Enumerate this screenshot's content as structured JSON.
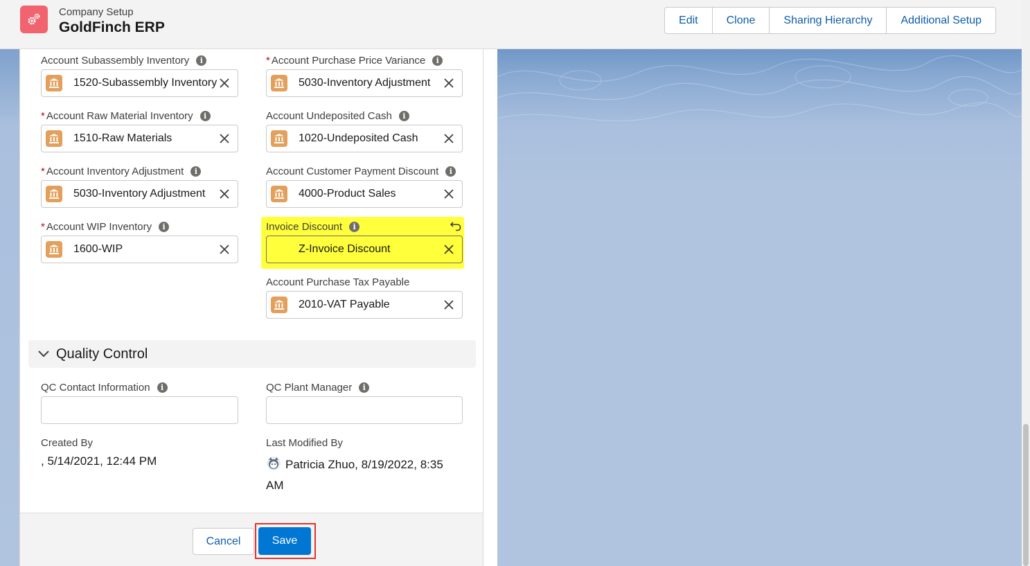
{
  "header": {
    "subtitle": "Company Setup",
    "title": "GoldFinch ERP",
    "actions": [
      "Edit",
      "Clone",
      "Sharing Hierarchy",
      "Additional Setup"
    ]
  },
  "fields": {
    "f1": {
      "label": "Account Subassembly Inventory",
      "required": false,
      "value": "1520-Subassembly Inventory"
    },
    "f2": {
      "label": "Account Purchase Price Variance",
      "required": true,
      "value": "5030-Inventory Adjustment"
    },
    "f3": {
      "label": "Account Raw Material Inventory",
      "required": true,
      "value": "1510-Raw Materials"
    },
    "f4": {
      "label": "Account Undeposited Cash",
      "required": false,
      "value": "1020-Undeposited Cash"
    },
    "f5": {
      "label": "Account Inventory Adjustment",
      "required": true,
      "value": "5030-Inventory Adjustment"
    },
    "f6": {
      "label": "Account Customer Payment Discount",
      "required": false,
      "value": "4000-Product Sales"
    },
    "f7": {
      "label": "Account WIP Inventory",
      "required": true,
      "value": "1600-WIP"
    },
    "f8": {
      "label": "Invoice Discount",
      "required": false,
      "value": "Z-Invoice Discount"
    },
    "f9": {
      "label": "Account Purchase Tax Payable",
      "required": false,
      "value": "2010-VAT Payable"
    }
  },
  "required_marker": "*",
  "section": {
    "title": "Quality Control"
  },
  "qc": {
    "contact_label": "QC Contact Information",
    "contact_value": "",
    "manager_label": "QC Plant Manager",
    "manager_value": ""
  },
  "audit": {
    "created_label": "Created By",
    "created_value": ", 5/14/2021, 12:44 PM",
    "modified_label": "Last Modified By",
    "modified_user": "Patricia Zhuo",
    "modified_date_line1": ", 8/19/2022, 8:35",
    "modified_date_line2": "AM"
  },
  "footer": {
    "cancel_label": "Cancel",
    "save_label": "Save"
  },
  "colors": {
    "brand": "#0176d3",
    "highlight": "#ffff3c",
    "required": "#ba0517",
    "lookup_icon": "#e3a05c"
  }
}
